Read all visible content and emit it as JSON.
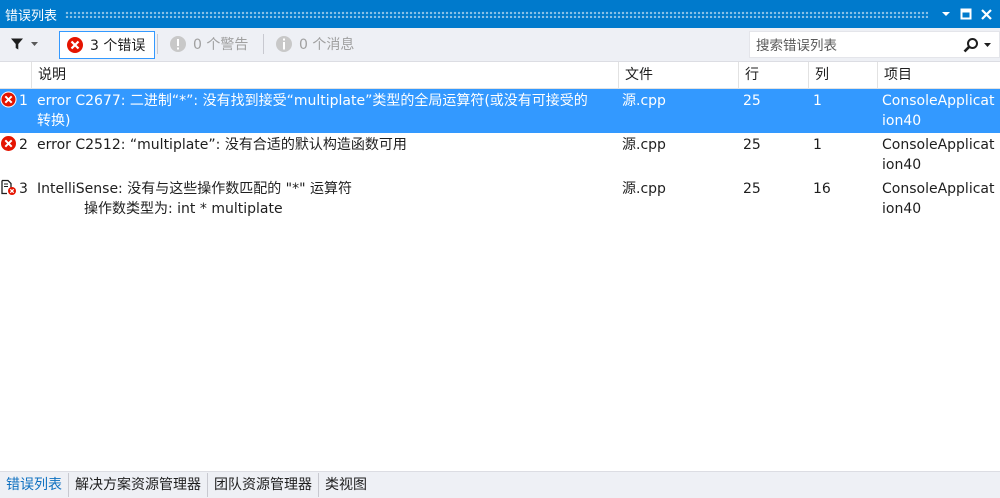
{
  "window": {
    "title": "错误列表"
  },
  "toolbar": {
    "errors_label": "3 个错误",
    "warnings_label": "0 个警告",
    "messages_label": "0 个消息",
    "search_placeholder": "搜索错误列表"
  },
  "columns": {
    "description": "说明",
    "file": "文件",
    "line": "行",
    "column": "列",
    "project": "项目"
  },
  "rows": [
    {
      "num": "1",
      "type": "error",
      "desc_line1": "error C2677: 二进制“*”: 没有找到接受“multiplate”类型的全局运算符(或没有可接受的",
      "desc_line2": "转换)",
      "file": "源.cpp",
      "line": "25",
      "column": "1",
      "project": "ConsoleApplication40",
      "selected": true
    },
    {
      "num": "2",
      "type": "error",
      "desc_line1": "error C2512: “multiplate”: 没有合适的默认构造函数可用",
      "desc_line2": "",
      "file": "源.cpp",
      "line": "25",
      "column": "1",
      "project": "ConsoleApplication40",
      "selected": false
    },
    {
      "num": "3",
      "type": "intellisense",
      "desc_line1": "IntelliSense: 没有与这些操作数匹配的 \"*\" 运算符",
      "desc_line2": "操作数类型为: int * multiplate",
      "file": "源.cpp",
      "line": "25",
      "column": "16",
      "project": "ConsoleApplication40",
      "selected": false
    }
  ],
  "bottom_tabs": [
    {
      "label": "错误列表",
      "active": true
    },
    {
      "label": "解决方案资源管理器",
      "active": false
    },
    {
      "label": "团队资源管理器",
      "active": false
    },
    {
      "label": "类视图",
      "active": false
    }
  ],
  "colors": {
    "accent": "#007acc",
    "selection": "#3399ff",
    "error_red": "#e51400",
    "toolbar_bg": "#eef0f5"
  },
  "icons": {
    "filter": "filter-icon",
    "error": "error-circle-icon",
    "warning": "warning-icon",
    "info": "info-icon",
    "search": "search-icon",
    "pin": "pin-icon",
    "restore": "restore-window-icon",
    "close": "close-icon"
  }
}
